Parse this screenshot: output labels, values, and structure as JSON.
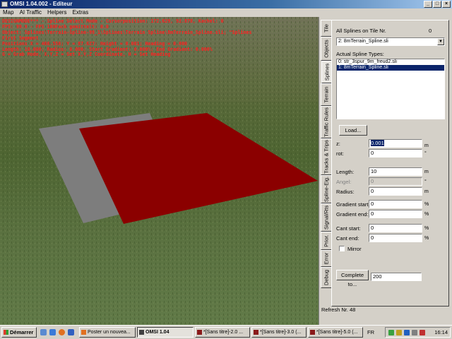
{
  "window": {
    "title": "OMSI 1.04.002 - Editeur",
    "min_icon": "minimize-icon",
    "max_icon": "maximize-icon",
    "close_icon": "close-icon"
  },
  "menu": {
    "items": [
      "Map",
      "AI Traffic",
      "Helpers",
      "Extras"
    ]
  },
  "viewport": {
    "debug_lines": [
      "DESIGNMODE*** - Spline Select Mode - Cursorposition: 172.629, 92.878, Kachel: 0",
      "FPS: 99.9 - FPS 100Fach gemittelt: 0.0",
      "Object: Splines\\Terrain-Spline-99_1\\Splines\\Terrain Spline\\8mTerrain_Spline.sli; \"Splines",
      "First Segment",
      "Positions X = 466.556; Y = 87.627; Height = 0.001; Heading = 0.000",
      "Length: 10.000; Radius: 0.000; Start Gradient: 0.000%; End Gradient: 0.000%",
      "G = Grab Mode, X,Y,Z = Set X,Y,Z Coordinate, H = Set Heading"
    ],
    "debug_color": "#ff2020",
    "spline_color": "#8b0000",
    "grey_color": "#7d7d7d"
  },
  "panel": {
    "tabs": [
      "Tile",
      "Objects",
      "Splines",
      "Terrain",
      "Traffic Rules",
      "Tracks & Trips",
      "Spline-Eig.",
      "Signal/Rts",
      "Prior.",
      "Error",
      "Debug"
    ],
    "active_tab": "Splines",
    "all_splines_label": "All Splines on Tile Nr.",
    "tile_nr": "0",
    "spline_combo": "2: 8mTerrain_Spline.sli",
    "actual_types_label": "Actual Spline Types:",
    "spline_types": [
      {
        "label": "0: str_3spur_9m_freud2.sli",
        "selected": false
      },
      {
        "label": "1: 8mTerrain_Spline.sli",
        "selected": true
      }
    ],
    "load_button": "Load...",
    "fields": {
      "z": {
        "label": "z:",
        "value": "0.001",
        "unit": "m"
      },
      "rot": {
        "label": "rot:",
        "value": "0",
        "unit": "°"
      },
      "length": {
        "label": "Length:",
        "value": "10",
        "unit": "m"
      },
      "angel": {
        "label": "Angel:",
        "value": "0",
        "unit": "°"
      },
      "radius": {
        "label": "Radius:",
        "value": "0",
        "unit": "m"
      },
      "gradient_start": {
        "label": "Gradient start:",
        "value": "0",
        "unit": "%"
      },
      "gradient_end": {
        "label": "Gradient end:",
        "value": "0",
        "unit": "%"
      },
      "cant_start": {
        "label": "Cant start:",
        "value": "0",
        "unit": "%"
      },
      "cant_end": {
        "label": "Cant end:",
        "value": "0",
        "unit": "%"
      }
    },
    "mirror_label": "Mirror",
    "complete_button": "Complete to...",
    "complete_value": "200",
    "refresh_label": "Refresh Nr. 48"
  },
  "taskbar": {
    "start_label": "Démarrer",
    "buttons": [
      {
        "label": "Poster un nouvea...",
        "active": false,
        "icon_color": "#e07020"
      },
      {
        "label": "OMSI 1.04",
        "active": true,
        "icon_color": "#404040"
      },
      {
        "label": "*[Sans titre]-2.0 ...",
        "active": false,
        "icon_color": "#8a1a1a"
      },
      {
        "label": "*[Sans titre]-3.0 (...",
        "active": false,
        "icon_color": "#8a1a1a"
      },
      {
        "label": "*[Sans titre]-5.0 (...",
        "active": false,
        "icon_color": "#8a1a1a"
      }
    ],
    "lang": "FR",
    "clock": "16:14"
  }
}
